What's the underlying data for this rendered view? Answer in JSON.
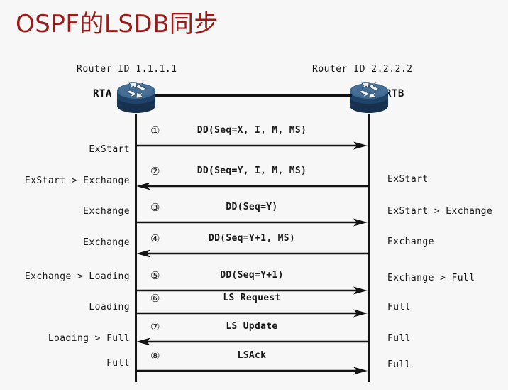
{
  "title": "OSPF的LSDB同步",
  "colors": {
    "title": "#9b1b1b",
    "background": "#f7f7f7",
    "line": "#141414",
    "router_body": "#1c3a5e",
    "router_top": "#43719c"
  },
  "routers": {
    "left": {
      "router_id_label": "Router ID 1.1.1.1",
      "name": "RTA",
      "icon": "router-icon"
    },
    "right": {
      "router_id_label": "Router ID 2.2.2.2",
      "name": "RTB",
      "icon": "router-icon"
    }
  },
  "messages": [
    {
      "seq": "①",
      "label": "DD(Seq=X, I, M, MS)",
      "direction": "right"
    },
    {
      "seq": "②",
      "label": "DD(Seq=Y, I, M, MS)",
      "direction": "left"
    },
    {
      "seq": "③",
      "label": "DD(Seq=Y)",
      "direction": "right"
    },
    {
      "seq": "④",
      "label": "DD(Seq=Y+1, MS)",
      "direction": "left"
    },
    {
      "seq": "⑤",
      "label": "DD(Seq=Y+1)",
      "direction": "right"
    },
    {
      "seq": "⑥",
      "label": "LS Request",
      "direction": "right"
    },
    {
      "seq": "⑦",
      "label": "LS Update",
      "direction": "left"
    },
    {
      "seq": "⑧",
      "label": "LSAck",
      "direction": "right"
    }
  ],
  "states_left": [
    "ExStart",
    "ExStart > Exchange",
    "Exchange",
    "Exchange",
    "Exchange > Loading",
    "Loading",
    "Loading > Full",
    "Full"
  ],
  "states_right": [
    "ExStart",
    "ExStart > Exchange",
    "Exchange",
    "Exchange > Full",
    "Full",
    "Full",
    "Full"
  ]
}
